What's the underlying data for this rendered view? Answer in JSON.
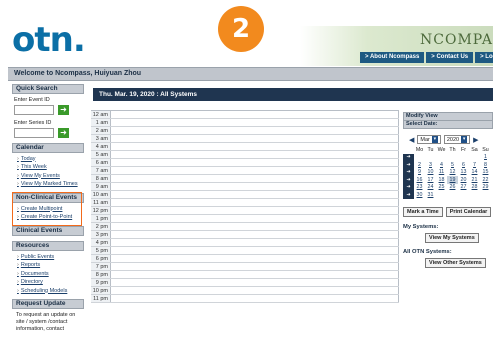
{
  "header": {
    "logo": "otn",
    "brand": "NCOMPASS",
    "step_number": "2",
    "nav": [
      "> About Ncompass",
      "> Contact Us",
      "> Logout"
    ]
  },
  "welcome": "Welcome to Ncompass, Huiyuan Zhou",
  "sidebar": {
    "quick_search": {
      "title": "Quick Search",
      "event_label": "Enter Event ID",
      "series_label": "Enter Series ID"
    },
    "calendar": {
      "title": "Calendar",
      "links": [
        "Today",
        "This Week",
        "View My Events",
        "View My Marked Times"
      ]
    },
    "non_clinical": {
      "title": "Non-Clinical Events",
      "links": [
        "Create Multipoint",
        "Create Point-to-Point"
      ]
    },
    "clinical": {
      "title": "Clinical Events"
    },
    "resources": {
      "title": "Resources",
      "links": [
        "Public Events",
        "Reports",
        "Documents",
        "Directory",
        "Scheduling Models"
      ]
    },
    "request_update": {
      "title": "Request Update",
      "text": "To request an update on site / system /contact information, contact"
    }
  },
  "date_header": "Thu. Mar. 19, 2020 : All Systems",
  "times": [
    "12 am",
    "1 am",
    "2 am",
    "3 am",
    "4 am",
    "5 am",
    "6 am",
    "7 am",
    "8 am",
    "9 am",
    "10 am",
    "11 am",
    "12 pm",
    "1 pm",
    "2 pm",
    "3 pm",
    "4 pm",
    "5 pm",
    "6 pm",
    "7 pm",
    "8 pm",
    "9 pm",
    "10 pm",
    "11 pm"
  ],
  "right_panel": {
    "title": "Modify View",
    "select_date": "Select Date:",
    "month": "Mar",
    "year": "2020",
    "weekdays": [
      "Mo",
      "Tu",
      "We",
      "Th",
      "Fr",
      "Sa",
      "Su"
    ],
    "weeks": [
      [
        "",
        "",
        "",
        "",
        "",
        "",
        "1"
      ],
      [
        "2",
        "3",
        "4",
        "5",
        "6",
        "7",
        "8"
      ],
      [
        "9",
        "10",
        "11",
        "12",
        "13",
        "14",
        "15"
      ],
      [
        "16",
        "17",
        "18",
        "19",
        "20",
        "21",
        "22"
      ],
      [
        "23",
        "24",
        "25",
        "26",
        "27",
        "28",
        "29"
      ],
      [
        "30",
        "31",
        "",
        "",
        "",
        "",
        ""
      ]
    ],
    "mark_time": "Mark a Time",
    "print_calendar": "Print Calendar",
    "my_systems_label": "My Systems:",
    "view_my_systems": "View My Systems",
    "all_otn_label": "All OTN Systems:",
    "view_other_systems": "View Other Systems"
  },
  "colors": {
    "accent_orange": "#f28a1e",
    "highlight_border": "#f26a1b",
    "nav_blue": "#1e5a82",
    "date_bar": "#1f3550",
    "logo_blue": "#0b6fa6"
  }
}
